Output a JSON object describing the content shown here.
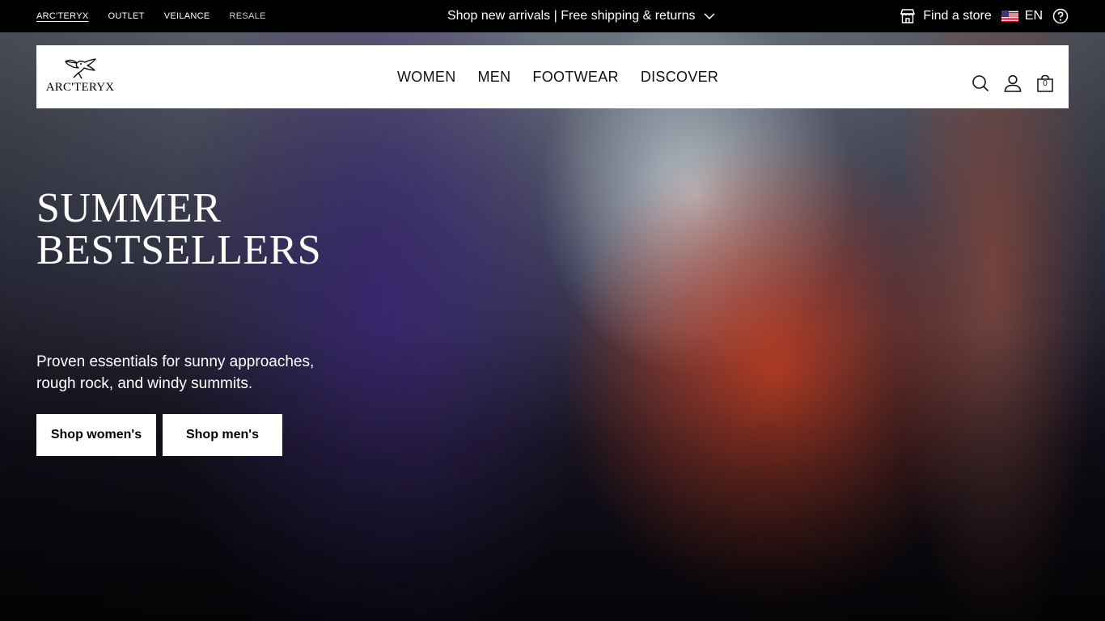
{
  "topbar": {
    "brands": [
      {
        "label": "ARC'TERYX"
      },
      {
        "label": "OUTLET"
      },
      {
        "label": "VEILANCE"
      },
      {
        "label": "RESALE"
      }
    ],
    "promo": "Shop new arrivals | Free shipping & returns",
    "store_link": "Find a store",
    "language": "EN"
  },
  "header": {
    "logo_text": "ARC'TERYX",
    "nav": [
      {
        "label": "WOMEN"
      },
      {
        "label": "MEN"
      },
      {
        "label": "FOOTWEAR"
      },
      {
        "label": "DISCOVER"
      }
    ],
    "cart_count": "0"
  },
  "hero": {
    "title_line1": "SUMMER",
    "title_line2": "BESTSELLERS",
    "subtitle": "Proven essentials for sunny approaches, rough rock, and windy summits.",
    "buttons": [
      {
        "label": "Shop women's"
      },
      {
        "label": "Shop men's"
      }
    ]
  },
  "icons": [
    "chevron-down-icon",
    "store-icon",
    "us-flag-icon",
    "help-icon",
    "search-icon",
    "account-icon",
    "cart-icon",
    "archaeopteryx-logo-icon"
  ]
}
